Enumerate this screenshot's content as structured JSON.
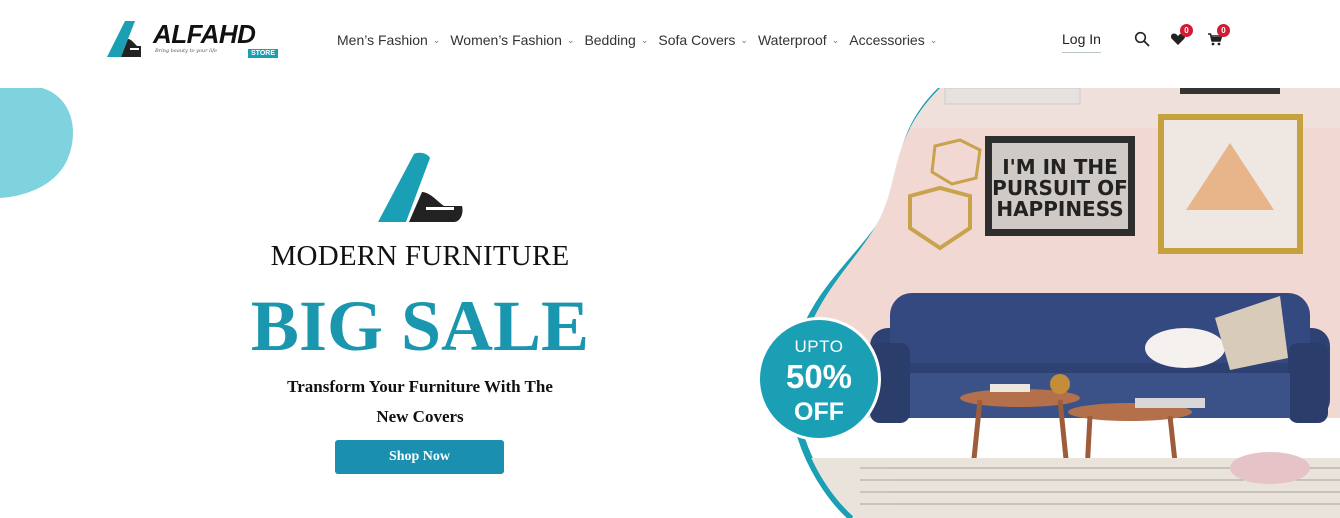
{
  "brand": {
    "name": "ALFAHD",
    "tagline": "Bring beauty to your life",
    "store_label": "STORE",
    "accent_color": "#1a9fb4"
  },
  "nav": {
    "items": [
      {
        "label": "Men’s Fashion"
      },
      {
        "label": "Women’s Fashion"
      },
      {
        "label": "Bedding"
      },
      {
        "label": "Sofa Covers"
      },
      {
        "label": "Waterproof"
      },
      {
        "label": "Accessories"
      }
    ],
    "chevron_icon": "chevron-down-icon"
  },
  "header_actions": {
    "login_label": "Log In",
    "search_icon": "search-icon",
    "wishlist_icon": "heart-icon",
    "wishlist_count": "0",
    "cart_icon": "cart-icon",
    "cart_count": "0",
    "badge_color": "#d31b35"
  },
  "hero": {
    "subtitle": "MODERN FURNITURE",
    "title": "BIG SALE",
    "description_line1": "Transform Your Furniture With The",
    "description_line2": "New Covers",
    "cta_label": "Shop Now",
    "promo": {
      "top": "UPTO",
      "middle": "50%",
      "bottom": "OFF"
    },
    "poster_text_line1": "I'M IN THE",
    "poster_text_line2": "PURSUIT OF",
    "poster_text_line3": "HAPPINESS"
  }
}
